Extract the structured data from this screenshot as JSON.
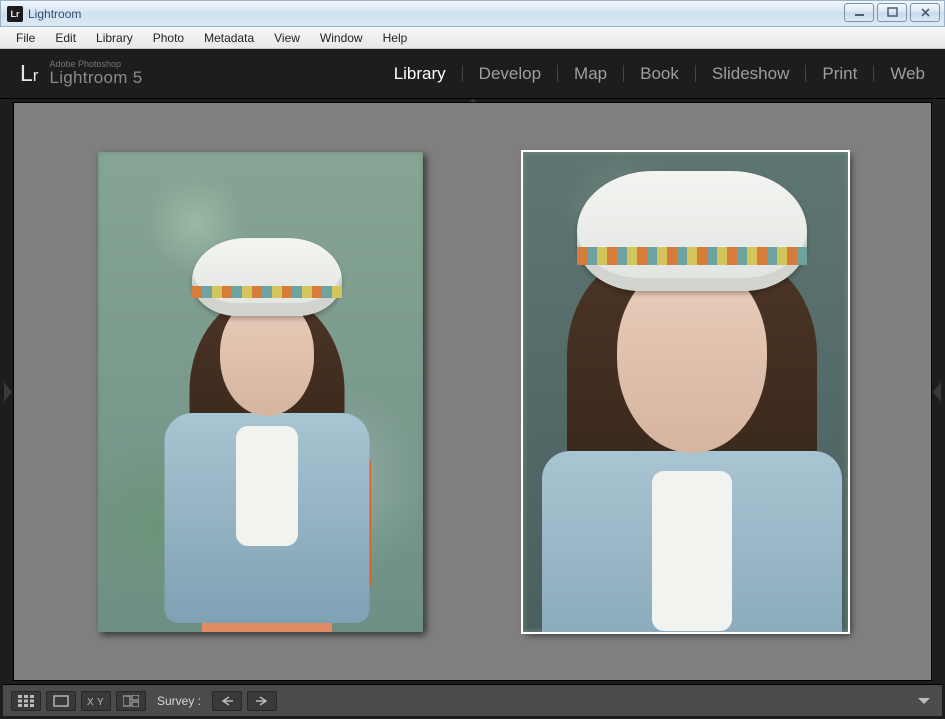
{
  "window": {
    "app_icon_text": "Lr",
    "title": "Lightroom"
  },
  "menubar": {
    "items": [
      "File",
      "Edit",
      "Library",
      "Photo",
      "Metadata",
      "View",
      "Window",
      "Help"
    ]
  },
  "branding": {
    "mark_L": "L",
    "mark_r": "r",
    "line1": "Adobe Photoshop",
    "line2": "Lightroom 5"
  },
  "modules": {
    "active_index": 0,
    "items": [
      "Library",
      "Develop",
      "Map",
      "Book",
      "Slideshow",
      "Print",
      "Web"
    ]
  },
  "survey": {
    "selected_index": 1,
    "photos": [
      {
        "variant": "full",
        "tone": "normal"
      },
      {
        "variant": "closeup",
        "tone": "muted"
      }
    ]
  },
  "toolbar": {
    "mode_label": "Survey :",
    "buttons": {
      "grid": "grid-view-icon",
      "loupe": "loupe-view-icon",
      "compare": "compare-view-icon",
      "survey": "survey-view-icon",
      "prev": "previous-photo-icon",
      "next": "next-photo-icon",
      "disclosure": "toolbar-disclosure-icon"
    }
  }
}
